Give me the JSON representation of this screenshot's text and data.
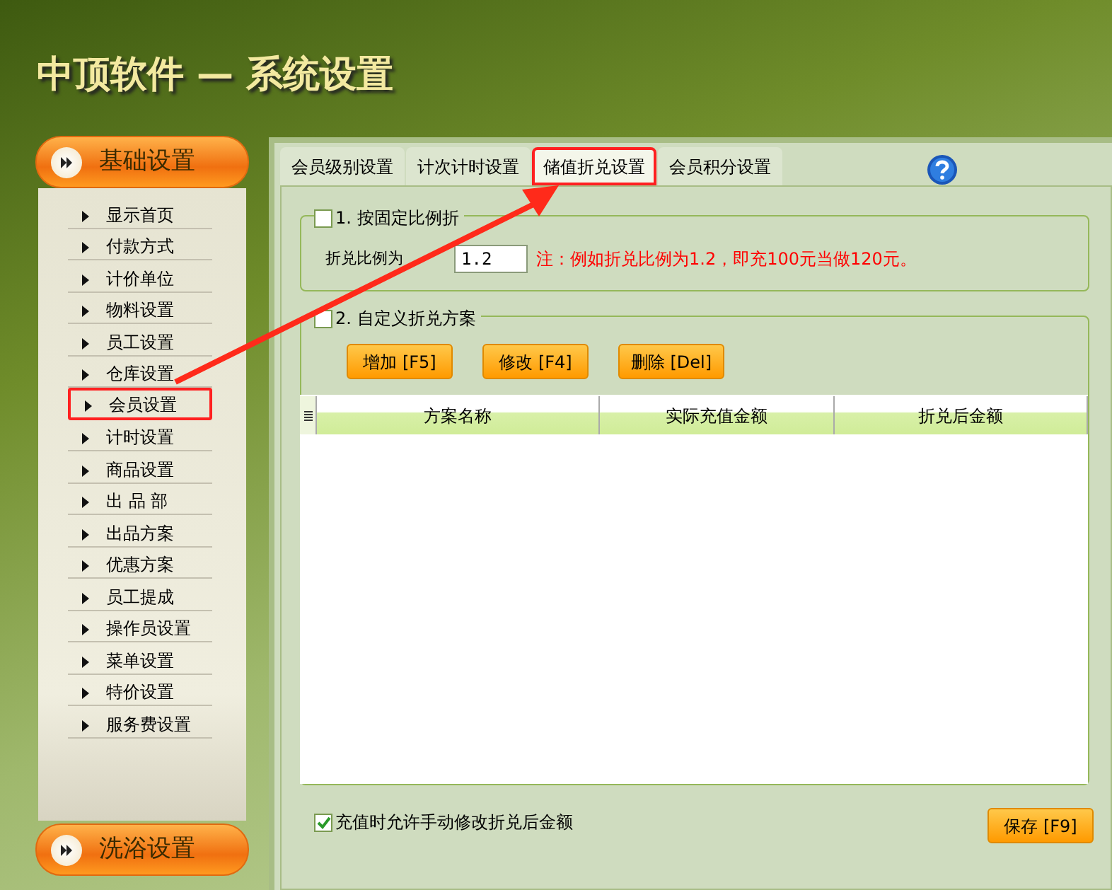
{
  "window": {
    "title": "中顶软件 — 系统设置"
  },
  "sidebar": {
    "sections": [
      {
        "label": "基础设置",
        "items": [
          {
            "label": "显示首页",
            "highlighted": false
          },
          {
            "label": "付款方式",
            "highlighted": false
          },
          {
            "label": "计价单位",
            "highlighted": false
          },
          {
            "label": "物料设置",
            "highlighted": false
          },
          {
            "label": "员工设置",
            "highlighted": false
          },
          {
            "label": "仓库设置",
            "highlighted": false
          },
          {
            "label": "会员设置",
            "highlighted": true
          },
          {
            "label": "计时设置",
            "highlighted": false
          },
          {
            "label": "商品设置",
            "highlighted": false
          },
          {
            "label": "出 品 部",
            "highlighted": false
          },
          {
            "label": "出品方案",
            "highlighted": false
          },
          {
            "label": "优惠方案",
            "highlighted": false
          },
          {
            "label": "员工提成",
            "highlighted": false
          },
          {
            "label": "操作员设置",
            "highlighted": false
          },
          {
            "label": "菜单设置",
            "highlighted": false
          },
          {
            "label": "特价设置",
            "highlighted": false
          },
          {
            "label": "服务费设置",
            "highlighted": false
          }
        ]
      },
      {
        "label": "洗浴设置"
      }
    ]
  },
  "tabs": [
    {
      "label": "会员级别设置",
      "selected": false,
      "highlighted": false
    },
    {
      "label": "计次计时设置",
      "selected": false,
      "highlighted": false
    },
    {
      "label": "储值折兑设置",
      "selected": true,
      "highlighted": true
    },
    {
      "label": "会员积分设置",
      "selected": false,
      "highlighted": false
    }
  ],
  "fixed_ratio": {
    "label": "1. 按固定比例折",
    "checked": false,
    "field_label": "折兑比例为",
    "value": "1.2",
    "note": "注：例如折兑比例为1.2，即充100元当做120元。"
  },
  "custom_plan": {
    "label": "2. 自定义折兑方案",
    "checked": false,
    "buttons": [
      "增加 [F5]",
      "修改 [F4]",
      "删除 [Del]"
    ],
    "table": {
      "columns": [
        "方案名称",
        "实际充值金额",
        "折兑后金额"
      ]
    }
  },
  "allow_manual": {
    "label": "充值时允许手动修改折兑后金额",
    "checked": true
  },
  "save_button": "保存 [F9]"
}
